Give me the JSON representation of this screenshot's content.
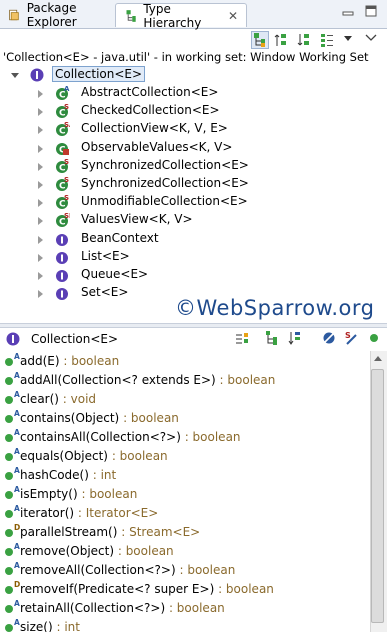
{
  "tabs": [
    {
      "label": "Package Explorer",
      "icon": "package-explorer-icon"
    },
    {
      "label": "Type Hierarchy",
      "icon": "type-hierarchy-icon",
      "close": "✕"
    }
  ],
  "status_text": "'Collection<E> - java.util' - in working set: Window Working Set",
  "tree": {
    "root": {
      "label": "Collection<E>",
      "icon": "interface-icon"
    },
    "children": [
      {
        "label": "AbstractCollection<E>",
        "icon": "abstract-class-icon",
        "badge": "A"
      },
      {
        "label": "CheckedCollection<E>",
        "icon": "class-icon",
        "badge": "S"
      },
      {
        "label": "CollectionView<K, V, E>",
        "icon": "class-icon",
        "badge": "SA"
      },
      {
        "label": "ObservableValues<K, V>",
        "icon": "class-icon",
        "badge": ""
      },
      {
        "label": "SynchronizedCollection<E>",
        "icon": "class-icon",
        "badge": "S"
      },
      {
        "label": "SynchronizedCollection<E>",
        "icon": "class-icon",
        "badge": "S"
      },
      {
        "label": "UnmodifiableCollection<E>",
        "icon": "class-icon",
        "badge": "S"
      },
      {
        "label": "ValuesView<K, V>",
        "icon": "class-icon",
        "badge": "SF"
      },
      {
        "label": "BeanContext",
        "icon": "interface-icon",
        "badge": ""
      },
      {
        "label": "List<E>",
        "icon": "interface-icon",
        "badge": ""
      },
      {
        "label": "Queue<E>",
        "icon": "interface-icon",
        "badge": ""
      },
      {
        "label": "Set<E>",
        "icon": "interface-icon",
        "badge": ""
      }
    ]
  },
  "watermark": "©WebSparrow.org",
  "members_header": {
    "label": "Collection<E>",
    "icon": "interface-icon"
  },
  "members": [
    {
      "mod": "A",
      "name": "add(E)",
      "ret": " : boolean"
    },
    {
      "mod": "A",
      "name": "addAll(Collection<? extends E>)",
      "ret": " : boolean"
    },
    {
      "mod": "A",
      "name": "clear()",
      "ret": " : void"
    },
    {
      "mod": "A",
      "name": "contains(Object)",
      "ret": " : boolean"
    },
    {
      "mod": "A",
      "name": "containsAll(Collection<?>)",
      "ret": " : boolean"
    },
    {
      "mod": "A",
      "name": "equals(Object)",
      "ret": " : boolean"
    },
    {
      "mod": "A",
      "name": "hashCode()",
      "ret": " : int"
    },
    {
      "mod": "A",
      "name": "isEmpty()",
      "ret": " : boolean"
    },
    {
      "mod": "A",
      "name": "iterator()",
      "ret": " : Iterator<E>"
    },
    {
      "mod": "D",
      "name": "parallelStream()",
      "ret": " : Stream<E>"
    },
    {
      "mod": "A",
      "name": "remove(Object)",
      "ret": " : boolean"
    },
    {
      "mod": "A",
      "name": "removeAll(Collection<?>)",
      "ret": " : boolean"
    },
    {
      "mod": "D",
      "name": "removeIf(Predicate<? super E>)",
      "ret": " : boolean"
    },
    {
      "mod": "A",
      "name": "retainAll(Collection<?>)",
      "ret": " : boolean"
    },
    {
      "mod": "A",
      "name": "size()",
      "ret": " : int"
    }
  ],
  "colors": {
    "accent": "#2c5aa0",
    "interface": "#5a3fb5",
    "class": "#2e8b3e",
    "return_type": "#8a6a2d"
  }
}
